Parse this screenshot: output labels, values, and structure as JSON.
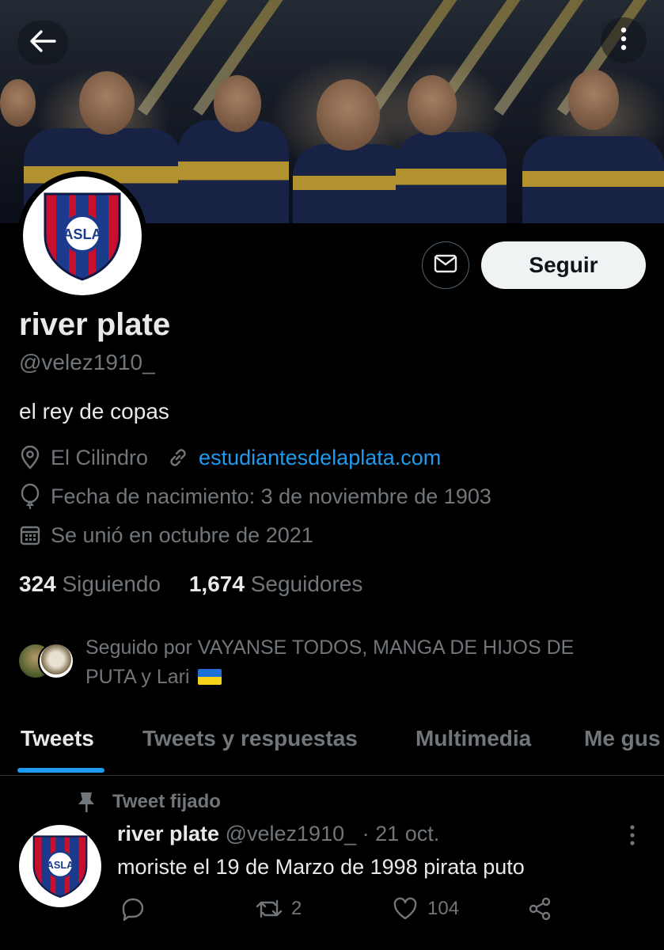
{
  "header": {
    "back_icon": "arrow-left-icon",
    "more_icon": "more-vertical-icon"
  },
  "profile": {
    "name": "river plate",
    "handle": "@velez1910_",
    "bio": "el rey de copas",
    "location": "El Cilindro",
    "website": "estudiantesdelaplata.com",
    "birthday": "Fecha de nacimiento: 3 de noviembre de 1903",
    "joined": "Se unió en octubre de 2021",
    "following_count": "324",
    "following_label": "Siguiendo",
    "followers_count": "1,674",
    "followers_label": "Seguidores",
    "followed_by_line1": "Seguido por VAYANSE TODOS, MANGA DE HIJOS DE",
    "followed_by_line2": "PUTA y Lari",
    "flag_icon": "ukraine-flag-icon"
  },
  "actions": {
    "follow_label": "Seguir",
    "message_icon": "envelope-icon"
  },
  "tabs": [
    {
      "label": "Tweets",
      "active": true
    },
    {
      "label": "Tweets y respuestas",
      "active": false
    },
    {
      "label": "Multimedia",
      "active": false
    },
    {
      "label": "Me gus",
      "active": false
    }
  ],
  "pinned_tweet": {
    "pinned_label": "Tweet fijado",
    "author_name": "river plate",
    "author_handle": "@velez1910_",
    "separator": "·",
    "date": "21 oct.",
    "text": "moriste el 19 de Marzo de 1998 pirata puto",
    "reply_count": "",
    "retweet_count": "2",
    "like_count": "104"
  },
  "colors": {
    "accent": "#1d9bf0",
    "background": "#000000",
    "text_primary": "#e7e9ea",
    "text_secondary": "#71767b",
    "crest_red": "#c8102e",
    "crest_blue": "#1b3a8c"
  }
}
